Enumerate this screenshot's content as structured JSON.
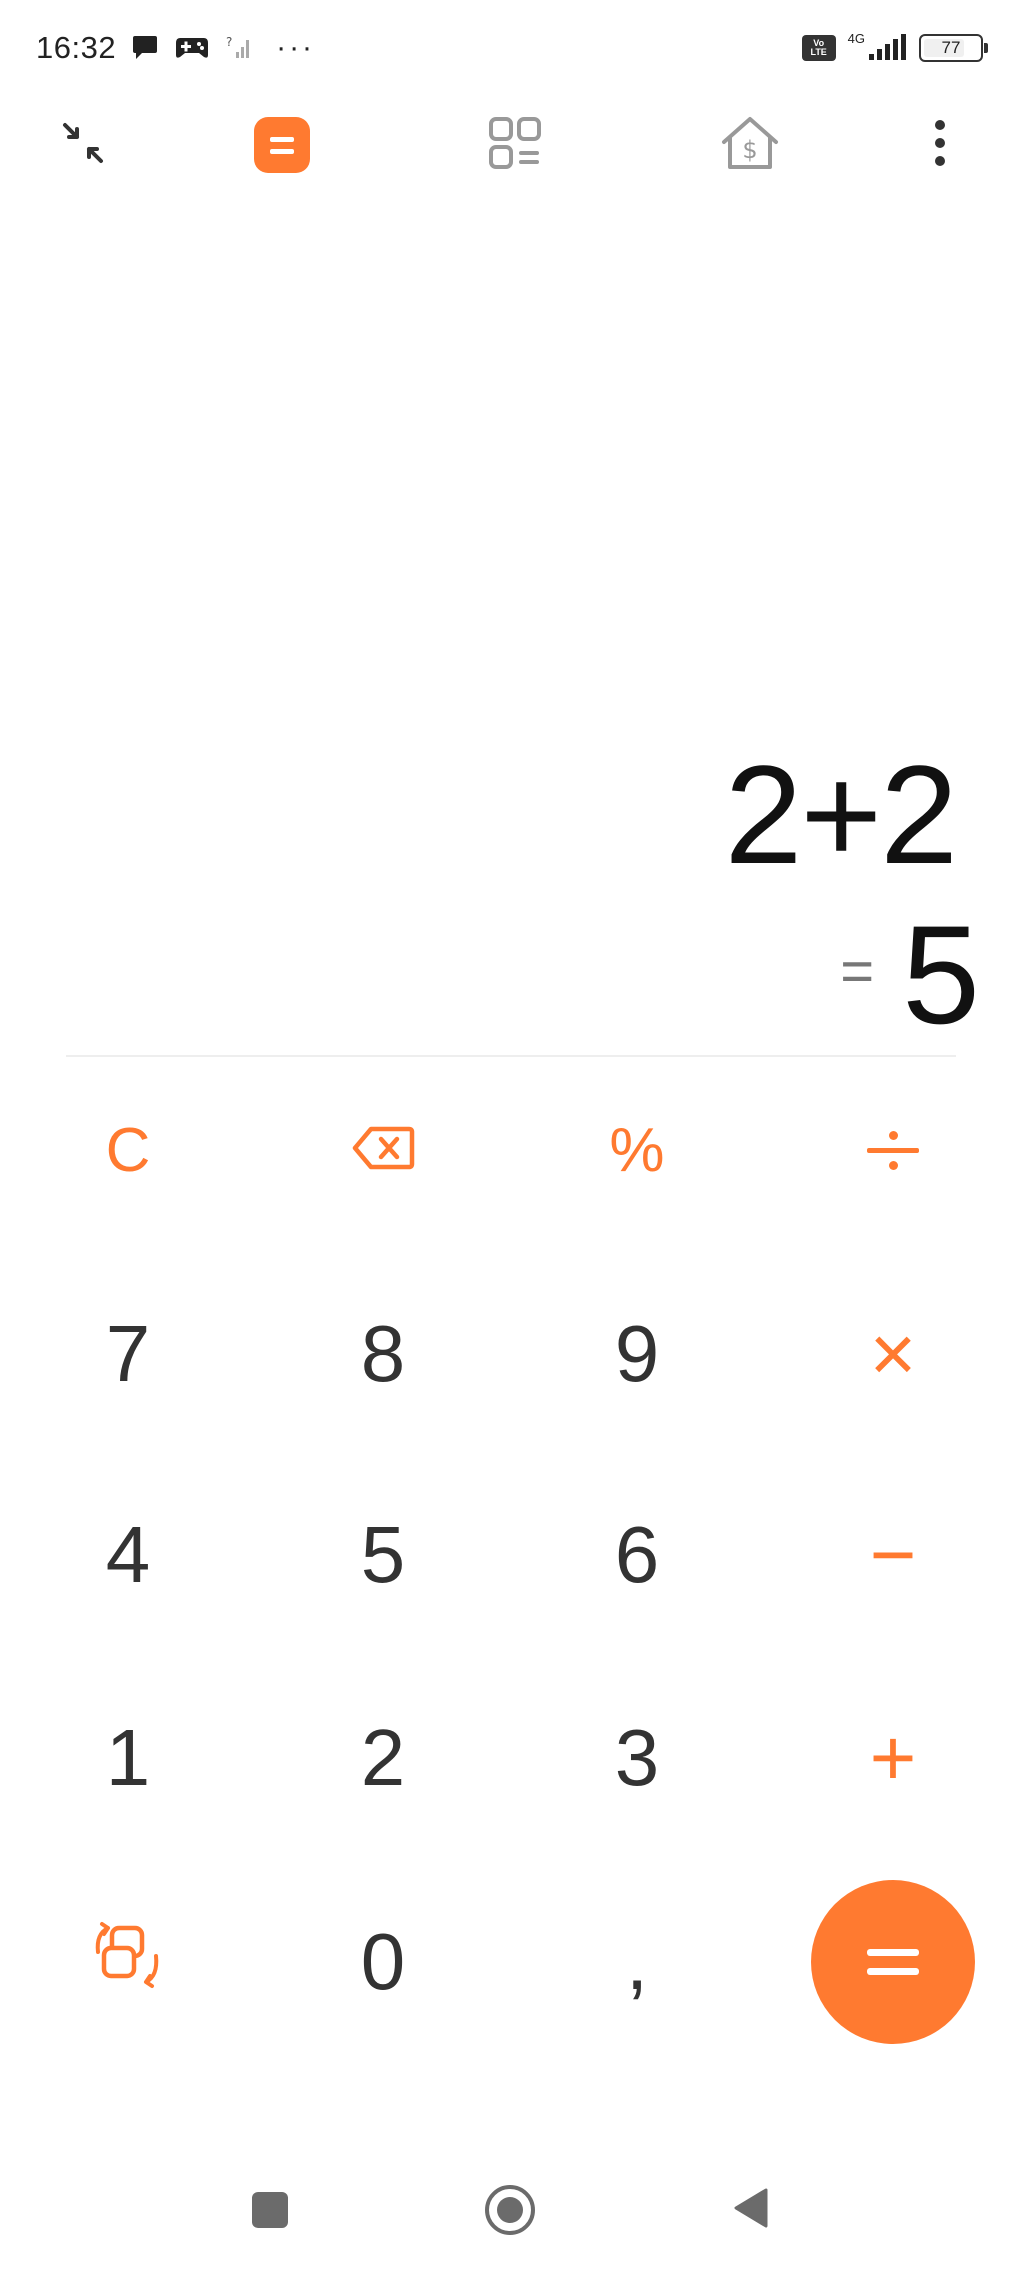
{
  "status_bar": {
    "time": "16:32",
    "dots": "···",
    "volte_top": "Vo",
    "volte_bottom": "LTE",
    "network": "4G",
    "battery": "77",
    "battery_level": 0.77
  },
  "toolbar": {
    "items": [
      {
        "id": "collapse",
        "icon": "collapse-arrows-icon"
      },
      {
        "id": "calculator",
        "icon": "calculator-icon",
        "active": true
      },
      {
        "id": "converter",
        "icon": "grid-list-icon"
      },
      {
        "id": "finance",
        "icon": "house-dollar-icon"
      },
      {
        "id": "more",
        "icon": "more-vertical-icon"
      }
    ]
  },
  "display": {
    "expression": "2+2",
    "result_prefix": "=",
    "result": "5"
  },
  "keypad": {
    "clear": "C",
    "backspace_icon": "backspace-icon",
    "percent": "%",
    "divide_icon": "divide-icon",
    "seven": "7",
    "eight": "8",
    "nine": "9",
    "multiply": "×",
    "four": "4",
    "five": "5",
    "six": "6",
    "minus": "−",
    "one": "1",
    "two": "2",
    "three": "3",
    "plus": "+",
    "switch_icon": "switch-mode-icon",
    "zero": "0",
    "decimal": ",",
    "equals_icon": "equals-icon"
  },
  "colors": {
    "accent": "#ff7a30",
    "digit": "#333333",
    "expression": "#111111",
    "nav": "#6b6b6b"
  },
  "nav_bar": {
    "recents_icon": "square-icon",
    "home_icon": "circle-icon",
    "back_icon": "triangle-back-icon"
  }
}
